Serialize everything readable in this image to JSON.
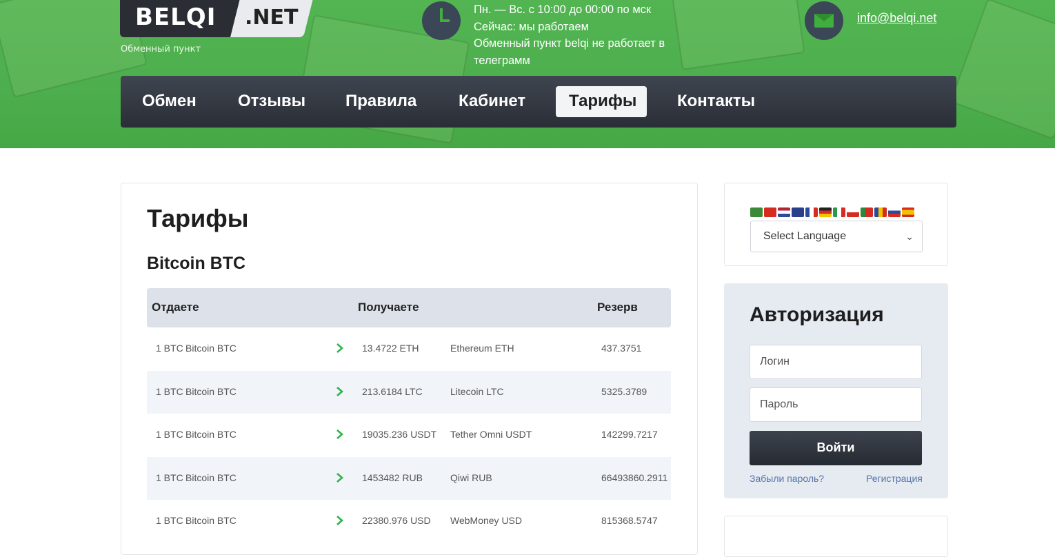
{
  "header": {
    "logo_left": "BELQI",
    "logo_right": ".NET",
    "tagline": "Обменный пункт",
    "hours": [
      "Пн. — Вс. с 10:00 до 00:00 по мск",
      "Сейчас: мы работаем",
      "Обменный пункт belqi не работает в телеграмм"
    ],
    "email": "info@belqi.net",
    "colors": {
      "green": "#4cae4c",
      "dark": "#2a2e36",
      "icon_circle": "#3b4656"
    }
  },
  "nav": {
    "items": [
      {
        "label": "Обмен"
      },
      {
        "label": "Отзывы"
      },
      {
        "label": "Правила"
      },
      {
        "label": "Кабинет"
      },
      {
        "label": "Тарифы",
        "active": true
      },
      {
        "label": "Контакты"
      }
    ]
  },
  "main": {
    "title": "Тарифы",
    "section": "Bitcoin BTC",
    "table": {
      "headers": [
        "Отдаете",
        "Получаете",
        "Резерв"
      ],
      "rows": [
        {
          "give_amount": "1 BTC",
          "give_name": "Bitcoin BTC",
          "get_amount": "13.4722 ETH",
          "get_name": "Ethereum ETH",
          "reserve": "437.3751"
        },
        {
          "give_amount": "1 BTC",
          "give_name": "Bitcoin BTC",
          "get_amount": "213.6184 LTC",
          "get_name": "Litecoin LTC",
          "reserve": "5325.3789"
        },
        {
          "give_amount": "1 BTC",
          "give_name": "Bitcoin BTC",
          "get_amount": "19035.236 USDT",
          "get_name": "Tether Omni USDT",
          "reserve": "142299.7217"
        },
        {
          "give_amount": "1 BTC",
          "give_name": "Bitcoin BTC",
          "get_amount": "1453482 RUB",
          "get_name": "Qiwi RUB",
          "reserve": "66493860.2911"
        },
        {
          "give_amount": "1 BTC",
          "give_name": "Bitcoin BTC",
          "get_amount": "22380.976 USD",
          "get_name": "WebMoney USD",
          "reserve": "815368.5747"
        }
      ]
    }
  },
  "sidebar": {
    "language": {
      "flags": [
        "ar",
        "zh",
        "nl",
        "en",
        "fr",
        "de",
        "it",
        "pl",
        "pt",
        "ro",
        "ru",
        "es"
      ],
      "select_value": "Select Language"
    },
    "auth": {
      "title": "Авторизация",
      "login_placeholder": "Логин",
      "password_placeholder": "Пароль",
      "submit_label": "Войти",
      "forgot_label": "Забыли пароль?",
      "register_label": "Регистрация"
    }
  }
}
